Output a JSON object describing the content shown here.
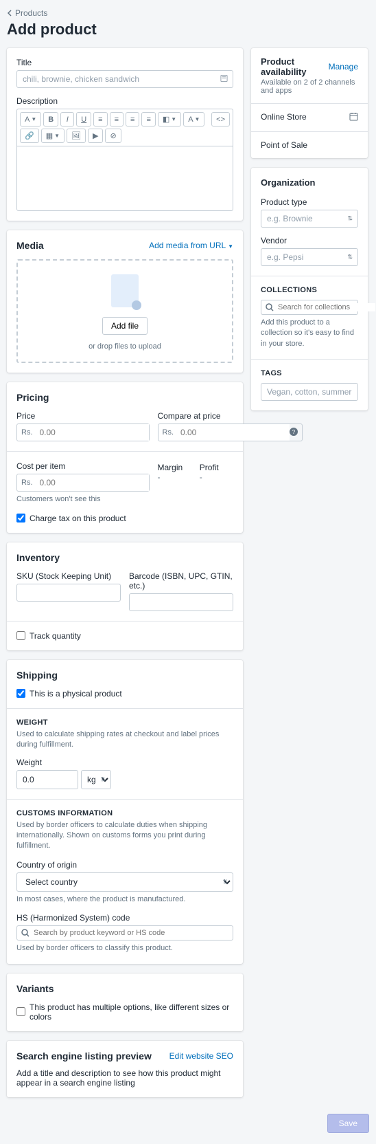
{
  "breadcrumb": "Products",
  "page_title": "Add product",
  "title_section": {
    "label": "Title",
    "placeholder": "chili, brownie, chicken sandwich"
  },
  "description_label": "Description",
  "media": {
    "title": "Media",
    "link": "Add media from URL",
    "button": "Add file",
    "hint": "or drop files to upload"
  },
  "pricing": {
    "title": "Pricing",
    "price_label": "Price",
    "compare_label": "Compare at price",
    "currency": "Rs.",
    "placeholder": "0.00",
    "cost_label": "Cost per item",
    "cost_help": "Customers won't see this",
    "margin_label": "Margin",
    "margin_value": "-",
    "profit_label": "Profit",
    "profit_value": "-",
    "tax_checkbox": "Charge tax on this product"
  },
  "inventory": {
    "title": "Inventory",
    "sku_label": "SKU (Stock Keeping Unit)",
    "barcode_label": "Barcode (ISBN, UPC, GTIN, etc.)",
    "track_checkbox": "Track quantity"
  },
  "shipping": {
    "title": "Shipping",
    "physical_checkbox": "This is a physical product",
    "weight_heading": "WEIGHT",
    "weight_help": "Used to calculate shipping rates at checkout and label prices during fulfillment.",
    "weight_label": "Weight",
    "weight_value": "0.0",
    "weight_unit": "kg",
    "customs_heading": "CUSTOMS INFORMATION",
    "customs_help": "Used by border officers to calculate duties when shipping internationally. Shown on customs forms you print during fulfillment.",
    "country_label": "Country of origin",
    "country_placeholder": "Select country",
    "country_help": "In most cases, where the product is manufactured.",
    "hs_label": "HS (Harmonized System) code",
    "hs_placeholder": "Search by product keyword or HS code",
    "hs_help": "Used by border officers to classify this product."
  },
  "variants": {
    "title": "Variants",
    "checkbox": "This product has multiple options, like different sizes or colors"
  },
  "seo": {
    "title": "Search engine listing preview",
    "link": "Edit website SEO",
    "help": "Add a title and description to see how this product might appear in a search engine listing"
  },
  "save_button": "Save",
  "availability": {
    "title": "Product availability",
    "manage": "Manage",
    "subtitle": "Available on 2 of 2 channels and apps",
    "online_store": "Online Store",
    "pos": "Point of Sale"
  },
  "organization": {
    "title": "Organization",
    "type_label": "Product type",
    "type_placeholder": "e.g. Brownie",
    "vendor_label": "Vendor",
    "vendor_placeholder": "e.g. Pepsi",
    "collections_heading": "COLLECTIONS",
    "collections_placeholder": "Search for collections",
    "collections_help": "Add this product to a collection so it's easy to find in your store.",
    "tags_heading": "TAGS",
    "tags_placeholder": "Vegan, cotton, summer"
  }
}
